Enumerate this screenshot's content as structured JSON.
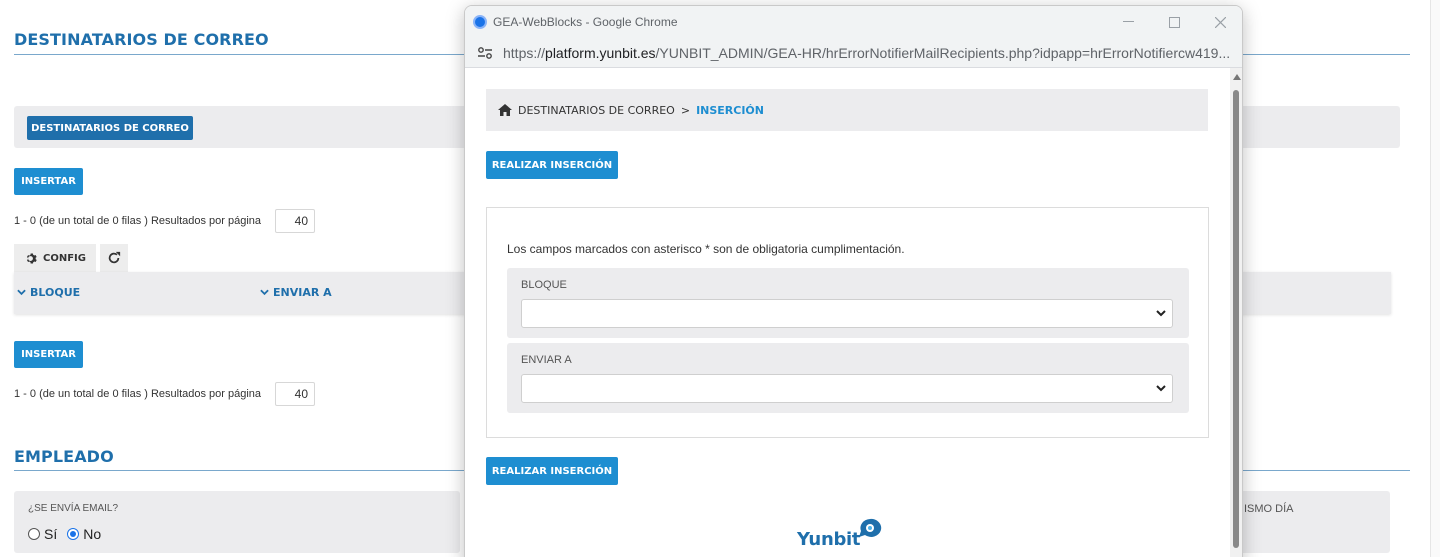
{
  "background": {
    "section1_title": "DESTINATARIOS DE CORREO",
    "tab_button": "DESTINATARIOS DE CORREO",
    "insert_top": "INSERTAR",
    "insert_bottom": "INSERTAR",
    "pager_text": "1 - 0 (de un total de 0 filas ) Resultados por página",
    "page_size": "40",
    "config_label": "CONFIG",
    "columns": [
      "BLOQUE",
      "ENVIAR A"
    ],
    "section2_title": "EMPLEADO",
    "email_question": "¿SE ENVÍA EMAIL?",
    "radio_yes": "Sí",
    "radio_no": "No",
    "radio_selected": "No",
    "partial_right_label": "ISMO DÍA"
  },
  "popup": {
    "window_title": "GEA-WebBlocks - Google Chrome",
    "url_prefix": "https://",
    "url_host": "platform.yunbit.es",
    "url_path": "/YUNBIT_ADMIN/GEA-HR/hrErrorNotifierMailRecipients.php?idpapp=hrErrorNotifiercw419...",
    "breadcrumb_home": "DESTINATARIOS DE CORREO",
    "breadcrumb_sep": ">",
    "breadcrumb_current": "INSERCIÓN",
    "submit_top": "REALIZAR INSERCIÓN",
    "submit_bottom": "REALIZAR INSERCIÓN",
    "required_note": "Los campos marcados con asterisco * son de obligatoria cumplimentación.",
    "fields": [
      {
        "label": "BLOQUE",
        "value": ""
      },
      {
        "label": "ENVIAR A",
        "value": ""
      }
    ],
    "logo_text": "Yunbit"
  },
  "colors": {
    "brand_dark": "#1f6fab",
    "brand_light": "#1e8ed1",
    "panel_grey": "#ececee"
  },
  "icons": [
    "gear-icon",
    "refresh-icon",
    "chevron-down-icon",
    "home-icon",
    "chrome-icon",
    "site-settings-icon",
    "minimize-icon",
    "maximize-icon",
    "close-icon"
  ]
}
